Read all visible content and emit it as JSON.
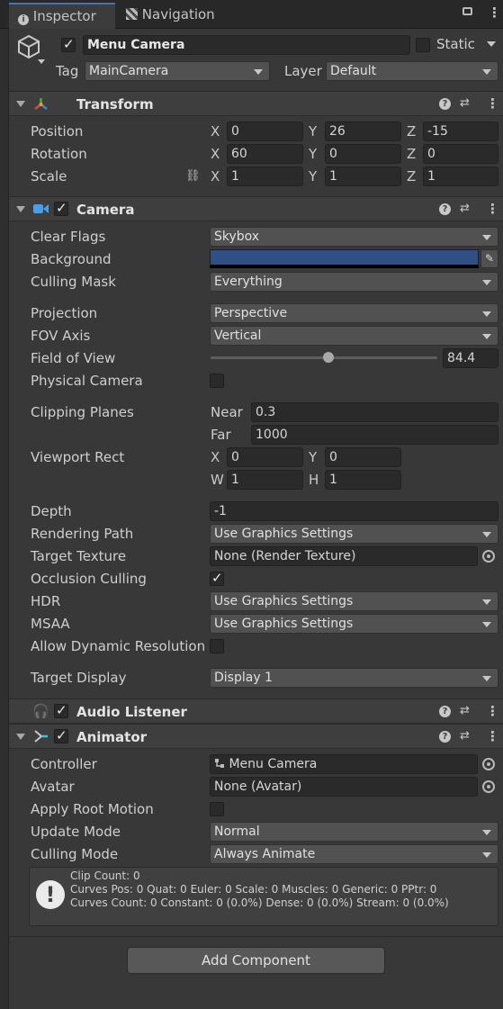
{
  "tabs": {
    "inspector": "Inspector",
    "navigation": "Navigation"
  },
  "header": {
    "object_name": "Menu Camera",
    "static_label": "Static",
    "tag_label": "Tag",
    "tag_value": "MainCamera",
    "layer_label": "Layer",
    "layer_value": "Default"
  },
  "transform": {
    "title": "Transform",
    "position_label": "Position",
    "rotation_label": "Rotation",
    "scale_label": "Scale",
    "axes": {
      "x": "X",
      "y": "Y",
      "z": "Z"
    },
    "position": {
      "x": "0",
      "y": "26",
      "z": "-15"
    },
    "rotation": {
      "x": "60",
      "y": "0",
      "z": "0"
    },
    "scale": {
      "x": "1",
      "y": "1",
      "z": "1"
    }
  },
  "camera": {
    "title": "Camera",
    "clear_flags": {
      "label": "Clear Flags",
      "value": "Skybox"
    },
    "background": {
      "label": "Background",
      "color": "#2f4f86"
    },
    "culling_mask": {
      "label": "Culling Mask",
      "value": "Everything"
    },
    "projection": {
      "label": "Projection",
      "value": "Perspective"
    },
    "fov_axis": {
      "label": "FOV Axis",
      "value": "Vertical"
    },
    "field_of_view": {
      "label": "Field of View",
      "value": "84.4",
      "fraction": 0.52
    },
    "physical_camera": {
      "label": "Physical Camera"
    },
    "clipping": {
      "label": "Clipping Planes",
      "near_label": "Near",
      "near": "0.3",
      "far_label": "Far",
      "far": "1000"
    },
    "viewport": {
      "label": "Viewport Rect",
      "x_label": "X",
      "x": "0",
      "y_label": "Y",
      "y": "0",
      "w_label": "W",
      "w": "1",
      "h_label": "H",
      "h": "1"
    },
    "depth": {
      "label": "Depth",
      "value": "-1"
    },
    "rendering_path": {
      "label": "Rendering Path",
      "value": "Use Graphics Settings"
    },
    "target_texture": {
      "label": "Target Texture",
      "value": "None (Render Texture)"
    },
    "occlusion_culling": {
      "label": "Occlusion Culling"
    },
    "hdr": {
      "label": "HDR",
      "value": "Use Graphics Settings"
    },
    "msaa": {
      "label": "MSAA",
      "value": "Use Graphics Settings"
    },
    "dynamic_resolution": {
      "label": "Allow Dynamic Resolution"
    },
    "target_display": {
      "label": "Target Display",
      "value": "Display 1"
    }
  },
  "audio_listener": {
    "title": "Audio Listener"
  },
  "animator": {
    "title": "Animator",
    "controller": {
      "label": "Controller",
      "value": "Menu Camera"
    },
    "avatar": {
      "label": "Avatar",
      "value": "None (Avatar)"
    },
    "apply_root_motion": {
      "label": "Apply Root Motion"
    },
    "update_mode": {
      "label": "Update Mode",
      "value": "Normal"
    },
    "culling_mode": {
      "label": "Culling Mode",
      "value": "Always Animate"
    },
    "info": {
      "line1": "Clip Count: 0",
      "line2": "Curves Pos: 0 Quat: 0 Euler: 0 Scale: 0 Muscles: 0 Generic: 0 PPtr: 0",
      "line3": "Curves Count: 0 Constant: 0 (0.0%) Dense: 0 (0.0%) Stream: 0 (0.0%)"
    }
  },
  "add_component": "Add Component",
  "colors": {
    "accent": "#3a79bb",
    "panel": "#383838",
    "camera_icon": "#4a9ee6",
    "audio_icon": "#e3b53a"
  }
}
